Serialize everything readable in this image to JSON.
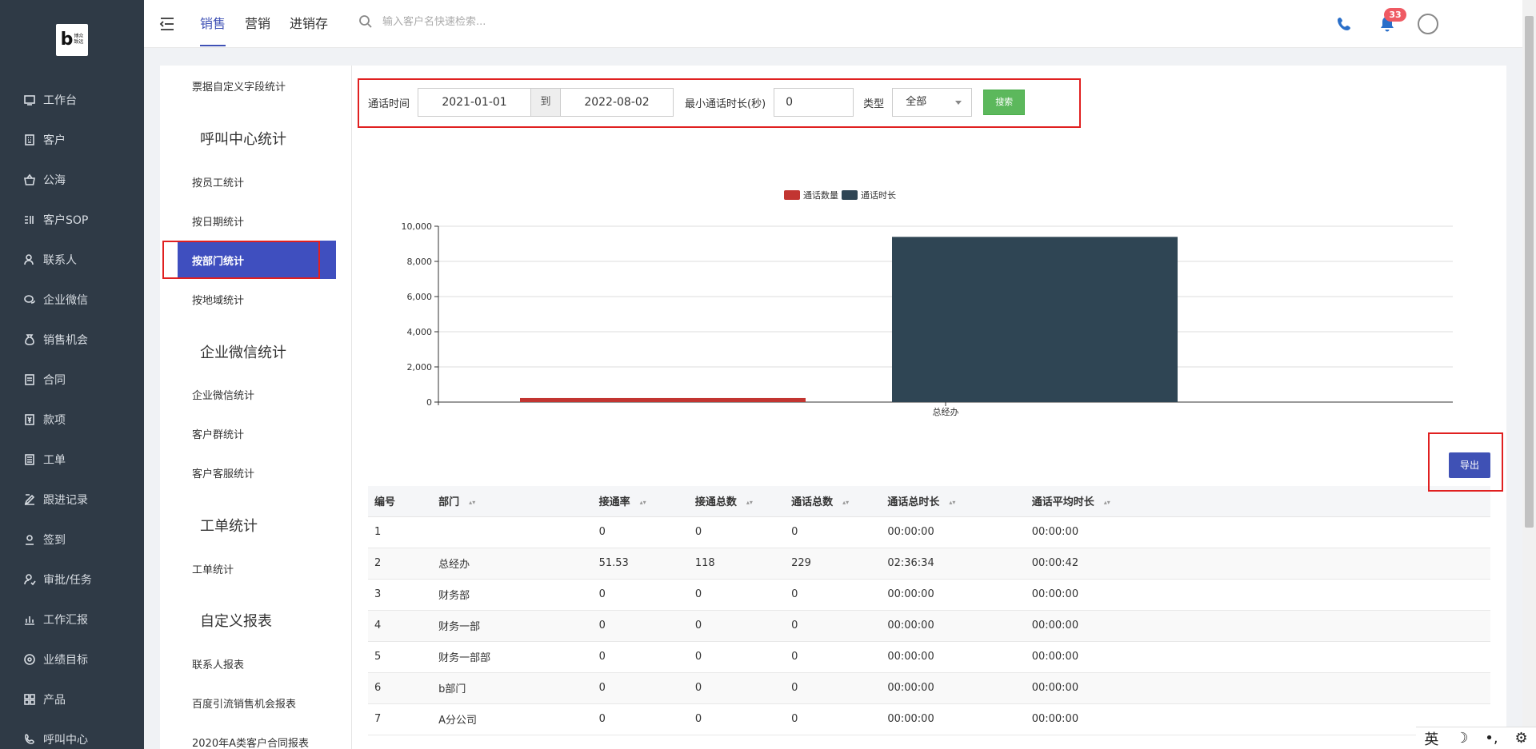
{
  "logo": {
    "letter": "b",
    "text_line1": "博众",
    "text_line2": "致远"
  },
  "nav": [
    {
      "label": "工作台",
      "icon": "desktop-icon"
    },
    {
      "label": "客户",
      "icon": "building-icon"
    },
    {
      "label": "公海",
      "icon": "basket-icon"
    },
    {
      "label": "客户SOP",
      "icon": "sop-icon"
    },
    {
      "label": "联系人",
      "icon": "contacts-icon"
    },
    {
      "label": "企业微信",
      "icon": "wechat-icon"
    },
    {
      "label": "销售机会",
      "icon": "money-bag-icon"
    },
    {
      "label": "合同",
      "icon": "contract-icon"
    },
    {
      "label": "款项",
      "icon": "payment-icon"
    },
    {
      "label": "工单",
      "icon": "ticket-icon"
    },
    {
      "label": "跟进记录",
      "icon": "edit-icon"
    },
    {
      "label": "签到",
      "icon": "checkin-icon"
    },
    {
      "label": "审批/任务",
      "icon": "approval-icon"
    },
    {
      "label": "工作汇报",
      "icon": "report-icon"
    },
    {
      "label": "业绩目标",
      "icon": "target-icon"
    },
    {
      "label": "产品",
      "icon": "grid-icon"
    },
    {
      "label": "呼叫中心",
      "icon": "call-center-icon"
    }
  ],
  "header": {
    "tabs": [
      "销售",
      "营销",
      "进销存"
    ],
    "search_placeholder": "输入客户名快速检索...",
    "notification_count": "33"
  },
  "side": {
    "item_top": "票据自定义字段统计",
    "group_call": "呼叫中心统计",
    "call_items": [
      "按员工统计",
      "按日期统计",
      "按部门统计",
      "按地域统计"
    ],
    "group_wechat": "企业微信统计",
    "wechat_items": [
      "企业微信统计",
      "客户群统计",
      "客户客服统计"
    ],
    "group_ticket": "工单统计",
    "ticket_items": [
      "工单统计"
    ],
    "group_custom": "自定义报表",
    "custom_items": [
      "联系人报表",
      "百度引流销售机会报表",
      "2020年A类客户合同报表"
    ]
  },
  "filter": {
    "time_label": "通话时间",
    "date_from": "2021-01-01",
    "to_label": "到",
    "date_to": "2022-08-02",
    "min_duration_label": "最小通话时长(秒)",
    "min_duration": "0",
    "type_label": "类型",
    "type_value": "全部",
    "search_btn": "搜索"
  },
  "chart_data": {
    "type": "bar",
    "categories": [
      "总经办"
    ],
    "series": [
      {
        "name": "通话数量",
        "values": [
          229
        ],
        "color": "#c23531"
      },
      {
        "name": "通话时长",
        "values": [
          9394
        ],
        "color": "#2f4554"
      }
    ],
    "yticks": [
      "10,000",
      "8,000",
      "6,000",
      "4,000",
      "2,000",
      "0"
    ],
    "ylim": [
      0,
      10000
    ],
    "legend_position": "top-center"
  },
  "export_btn": "导出",
  "table": {
    "headers": [
      "编号",
      "部门",
      "接通率",
      "接通总数",
      "通话总数",
      "通话总时长",
      "通话平均时长"
    ],
    "rows": [
      [
        "1",
        "",
        "0",
        "0",
        "0",
        "00:00:00",
        "00:00:00"
      ],
      [
        "2",
        "总经办",
        "51.53",
        "118",
        "229",
        "02:36:34",
        "00:00:42"
      ],
      [
        "3",
        "财务部",
        "0",
        "0",
        "0",
        "00:00:00",
        "00:00:00"
      ],
      [
        "4",
        "财务一部",
        "0",
        "0",
        "0",
        "00:00:00",
        "00:00:00"
      ],
      [
        "5",
        "财务一部部",
        "0",
        "0",
        "0",
        "00:00:00",
        "00:00:00"
      ],
      [
        "6",
        "b部门",
        "0",
        "0",
        "0",
        "00:00:00",
        "00:00:00"
      ],
      [
        "7",
        "A分公司",
        "0",
        "0",
        "0",
        "00:00:00",
        "00:00:00"
      ]
    ]
  },
  "ime": {
    "lang": "英"
  }
}
